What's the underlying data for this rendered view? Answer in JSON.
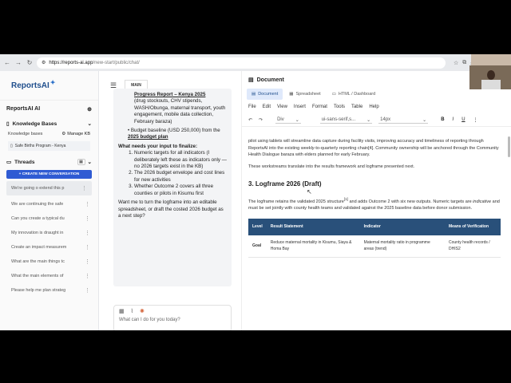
{
  "browser": {
    "url_host": "https://reports-ai.app",
    "url_path": "/new-start/public/chat/"
  },
  "sidebar": {
    "logo": "ReportsAI",
    "title": "ReportsAI AI",
    "knowledge_bases_label": "Knowledge Bases",
    "kb_label": "Knowledge bases",
    "manage_kb": "Manage KB",
    "kb_item": "Safe Births Program - Kenya",
    "threads_label": "Threads",
    "new_conversation": "+ CREATE NEW CONVERSATION",
    "threads": [
      "We're going o extend this p",
      "We are continuing the safe",
      "Can you create a typical du",
      "My innovation is draught in",
      "Create an impact measurem",
      "What are the main things tc",
      "What the main elements of",
      "Please help me plan strateg"
    ]
  },
  "chat": {
    "main_tag": "MAIN",
    "bubble": {
      "progress_title": "Progress Report – Kenya 2025",
      "progress_detail": "(drug stockouts, CHV stipends, WASH/Obunga, maternal transport, youth engagement, mobile data collection, February baraza)",
      "budget_bullet_a": "Budget baseline (USD 250,000) from the ",
      "budget_bullet_link": "2025 budget plan",
      "needs_input": "What needs your input to finalize:",
      "items": [
        "Numeric targets for all indicators (I deliberately left these as indicators only — no 2026 targets exist in the KB)",
        "The 2026 budget envelope and cost lines for new activities",
        "Whether Outcome 2 covers all three counties or pilots in Kisumu first"
      ],
      "closing": "Want me to turn the logframe into an editable spreadsheet, or draft the costed 2026 budget as a next step?"
    },
    "composer_placeholder": "What can I do for you today?"
  },
  "document": {
    "title": "Document",
    "tabs": [
      "Document",
      "Spreadsheet",
      "HTML / Dashboard"
    ],
    "menu": [
      "File",
      "Edit",
      "View",
      "Insert",
      "Format",
      "Tools",
      "Table",
      "Help"
    ],
    "toolbar": {
      "block": "Div",
      "font": "ui-sans-serif,s...",
      "size": "14px",
      "bold": "B",
      "italic": "I",
      "underline": "U"
    },
    "para1": "pilot using tablets will streamline data capture during facility visits, improving accuracy and timeliness of reporting through ReportsAI into the existing weekly-to-quarterly reporting chain[4]. Community ownership will be anchored through the Community Health Dialogue baraza with elders planned for early February.",
    "para2": "These workstreams translate into the results framework and logframe presented next.",
    "heading": "3. Logframe 2026 (Draft)",
    "para3a": "The logframe retains the validated 2025 structure",
    "para3_ref": "[1]",
    "para3b": " and adds Outcome 2 with six new outputs. Numeric targets are ",
    "para3_em": "indicative",
    "para3c": " and must be set jointly with county health teams and validated against the 2025 baseline data before donor submission.",
    "table": {
      "headers": [
        "Level",
        "Result Statement",
        "Indicator",
        "Means of Verification"
      ],
      "rows": [
        [
          "Goal",
          "Reduce maternal mortality in Kisumu, Siaya & Homa Bay",
          "Maternal mortality ratio in programme areas (trend)",
          "County health records / DHIS2"
        ]
      ]
    }
  }
}
